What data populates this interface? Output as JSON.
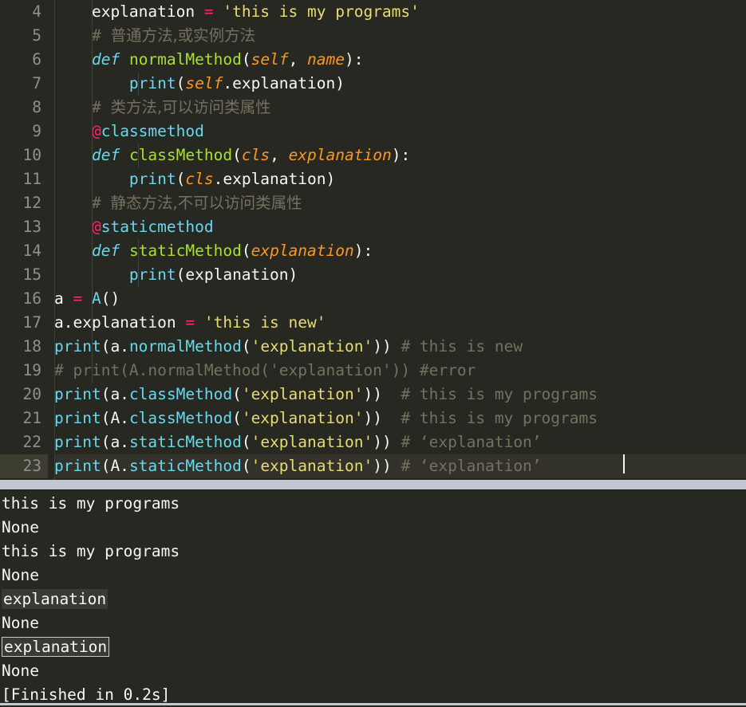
{
  "theme": {
    "editor_background": "#272822",
    "gutter_text": "#8f908a",
    "active_line_background": "#32322b",
    "active_gutter_background": "#3e3d32",
    "separator_color": "#c3c7d1",
    "foreground": "#f8f8f2",
    "keyword": "#66d9ef",
    "operator": "#f92672",
    "string": "#e6db74",
    "comment": "#75715e",
    "function": "#a6e22e",
    "parameter": "#fd971f",
    "caret": "#f8f8f0",
    "output_highlight_fill": "#3a3a34",
    "output_highlight_border": "#c9c9bf"
  },
  "editor": {
    "first_visible_line": 4,
    "active_line": 23,
    "lines": [
      {
        "n": "4",
        "tokens": [
          {
            "t": "plain",
            "v": "    explanation "
          },
          {
            "t": "op",
            "v": "="
          },
          {
            "t": "plain",
            "v": " "
          },
          {
            "t": "str",
            "v": "'this is my programs'"
          }
        ]
      },
      {
        "n": "5",
        "tokens": [
          {
            "t": "com",
            "v": "    # "
          },
          {
            "t": "cjk",
            "v": "普通方法,或实例方法"
          }
        ]
      },
      {
        "n": "6",
        "tokens": [
          {
            "t": "plain",
            "v": "    "
          },
          {
            "t": "kw",
            "v": "def"
          },
          {
            "t": "plain",
            "v": " "
          },
          {
            "t": "fn",
            "v": "normalMethod"
          },
          {
            "t": "plain",
            "v": "("
          },
          {
            "t": "param",
            "v": "self"
          },
          {
            "t": "plain",
            "v": ", "
          },
          {
            "t": "param",
            "v": "name"
          },
          {
            "t": "plain",
            "v": "):"
          }
        ]
      },
      {
        "n": "7",
        "tokens": [
          {
            "t": "plain",
            "v": "        "
          },
          {
            "t": "builtin",
            "v": "print"
          },
          {
            "t": "plain",
            "v": "("
          },
          {
            "t": "param",
            "v": "self"
          },
          {
            "t": "plain",
            "v": ".explanation)"
          }
        ]
      },
      {
        "n": "8",
        "tokens": [
          {
            "t": "com",
            "v": "    # "
          },
          {
            "t": "cjk",
            "v": "类方法,可以访问类属性"
          }
        ]
      },
      {
        "n": "9",
        "tokens": [
          {
            "t": "plain",
            "v": "    "
          },
          {
            "t": "decoat",
            "v": "@"
          },
          {
            "t": "builtin",
            "v": "classmethod"
          }
        ]
      },
      {
        "n": "10",
        "tokens": [
          {
            "t": "plain",
            "v": "    "
          },
          {
            "t": "kw",
            "v": "def"
          },
          {
            "t": "plain",
            "v": " "
          },
          {
            "t": "fn",
            "v": "classMethod"
          },
          {
            "t": "plain",
            "v": "("
          },
          {
            "t": "param",
            "v": "cls"
          },
          {
            "t": "plain",
            "v": ", "
          },
          {
            "t": "param",
            "v": "explanation"
          },
          {
            "t": "plain",
            "v": "):"
          }
        ]
      },
      {
        "n": "11",
        "tokens": [
          {
            "t": "plain",
            "v": "        "
          },
          {
            "t": "builtin",
            "v": "print"
          },
          {
            "t": "plain",
            "v": "("
          },
          {
            "t": "param",
            "v": "cls"
          },
          {
            "t": "plain",
            "v": ".explanation)"
          }
        ]
      },
      {
        "n": "12",
        "tokens": [
          {
            "t": "com",
            "v": "    # "
          },
          {
            "t": "cjk",
            "v": "静态方法,不可以访问类属性"
          }
        ]
      },
      {
        "n": "13",
        "tokens": [
          {
            "t": "plain",
            "v": "    "
          },
          {
            "t": "decoat",
            "v": "@"
          },
          {
            "t": "builtin",
            "v": "staticmethod"
          }
        ]
      },
      {
        "n": "14",
        "tokens": [
          {
            "t": "plain",
            "v": "    "
          },
          {
            "t": "kw",
            "v": "def"
          },
          {
            "t": "plain",
            "v": " "
          },
          {
            "t": "fn",
            "v": "staticMethod"
          },
          {
            "t": "plain",
            "v": "("
          },
          {
            "t": "param",
            "v": "explanation"
          },
          {
            "t": "plain",
            "v": "):"
          }
        ]
      },
      {
        "n": "15",
        "tokens": [
          {
            "t": "plain",
            "v": "        "
          },
          {
            "t": "builtin",
            "v": "print"
          },
          {
            "t": "plain",
            "v": "(explanation)"
          }
        ]
      },
      {
        "n": "16",
        "tokens": [
          {
            "t": "plain",
            "v": "a "
          },
          {
            "t": "op",
            "v": "="
          },
          {
            "t": "plain",
            "v": " "
          },
          {
            "t": "class",
            "v": "A"
          },
          {
            "t": "plain",
            "v": "()"
          }
        ]
      },
      {
        "n": "17",
        "tokens": [
          {
            "t": "plain",
            "v": "a.explanation "
          },
          {
            "t": "op",
            "v": "="
          },
          {
            "t": "plain",
            "v": " "
          },
          {
            "t": "str",
            "v": "'this is new'"
          }
        ]
      },
      {
        "n": "18",
        "tokens": [
          {
            "t": "builtin",
            "v": "print"
          },
          {
            "t": "plain",
            "v": "(a."
          },
          {
            "t": "attr",
            "v": "normalMethod"
          },
          {
            "t": "plain",
            "v": "("
          },
          {
            "t": "str",
            "v": "'explanation'"
          },
          {
            "t": "plain",
            "v": ")) "
          },
          {
            "t": "com",
            "v": "# this is new"
          }
        ]
      },
      {
        "n": "19",
        "tokens": [
          {
            "t": "com",
            "v": "# print(A.normalMethod('explanation')) #error"
          }
        ]
      },
      {
        "n": "20",
        "tokens": [
          {
            "t": "builtin",
            "v": "print"
          },
          {
            "t": "plain",
            "v": "(a."
          },
          {
            "t": "attr",
            "v": "classMethod"
          },
          {
            "t": "plain",
            "v": "("
          },
          {
            "t": "str",
            "v": "'explanation'"
          },
          {
            "t": "plain",
            "v": "))  "
          },
          {
            "t": "com",
            "v": "# this is my programs"
          }
        ]
      },
      {
        "n": "21",
        "tokens": [
          {
            "t": "builtin",
            "v": "print"
          },
          {
            "t": "plain",
            "v": "(A."
          },
          {
            "t": "attr",
            "v": "classMethod"
          },
          {
            "t": "plain",
            "v": "("
          },
          {
            "t": "str",
            "v": "'explanation'"
          },
          {
            "t": "plain",
            "v": "))  "
          },
          {
            "t": "com",
            "v": "# this is my programs"
          }
        ]
      },
      {
        "n": "22",
        "tokens": [
          {
            "t": "builtin",
            "v": "print"
          },
          {
            "t": "plain",
            "v": "(a."
          },
          {
            "t": "attr",
            "v": "staticMethod"
          },
          {
            "t": "plain",
            "v": "("
          },
          {
            "t": "str",
            "v": "'explanation'"
          },
          {
            "t": "plain",
            "v": ")) "
          },
          {
            "t": "com",
            "v": "# ‘explanation’"
          }
        ]
      },
      {
        "n": "23",
        "tokens": [
          {
            "t": "builtin",
            "v": "print"
          },
          {
            "t": "plain",
            "v": "(A."
          },
          {
            "t": "attr",
            "v": "staticMethod"
          },
          {
            "t": "plain",
            "v": "("
          },
          {
            "t": "str",
            "v": "'explanation'"
          },
          {
            "t": "plain",
            "v": ")) "
          },
          {
            "t": "com",
            "v": "# ‘explanation’"
          }
        ]
      }
    ]
  },
  "output": {
    "lines": [
      {
        "text": "this is my programs",
        "style": "plain"
      },
      {
        "text": "None",
        "style": "plain"
      },
      {
        "text": "this is my programs",
        "style": "plain"
      },
      {
        "text": "None",
        "style": "plain"
      },
      {
        "text": "explanation",
        "style": "highlight-fill"
      },
      {
        "text": "None",
        "style": "plain"
      },
      {
        "text": "explanation",
        "style": "highlight-box"
      },
      {
        "text": "None",
        "style": "plain"
      },
      {
        "text": "[Finished in 0.2s]",
        "style": "plain"
      }
    ]
  }
}
